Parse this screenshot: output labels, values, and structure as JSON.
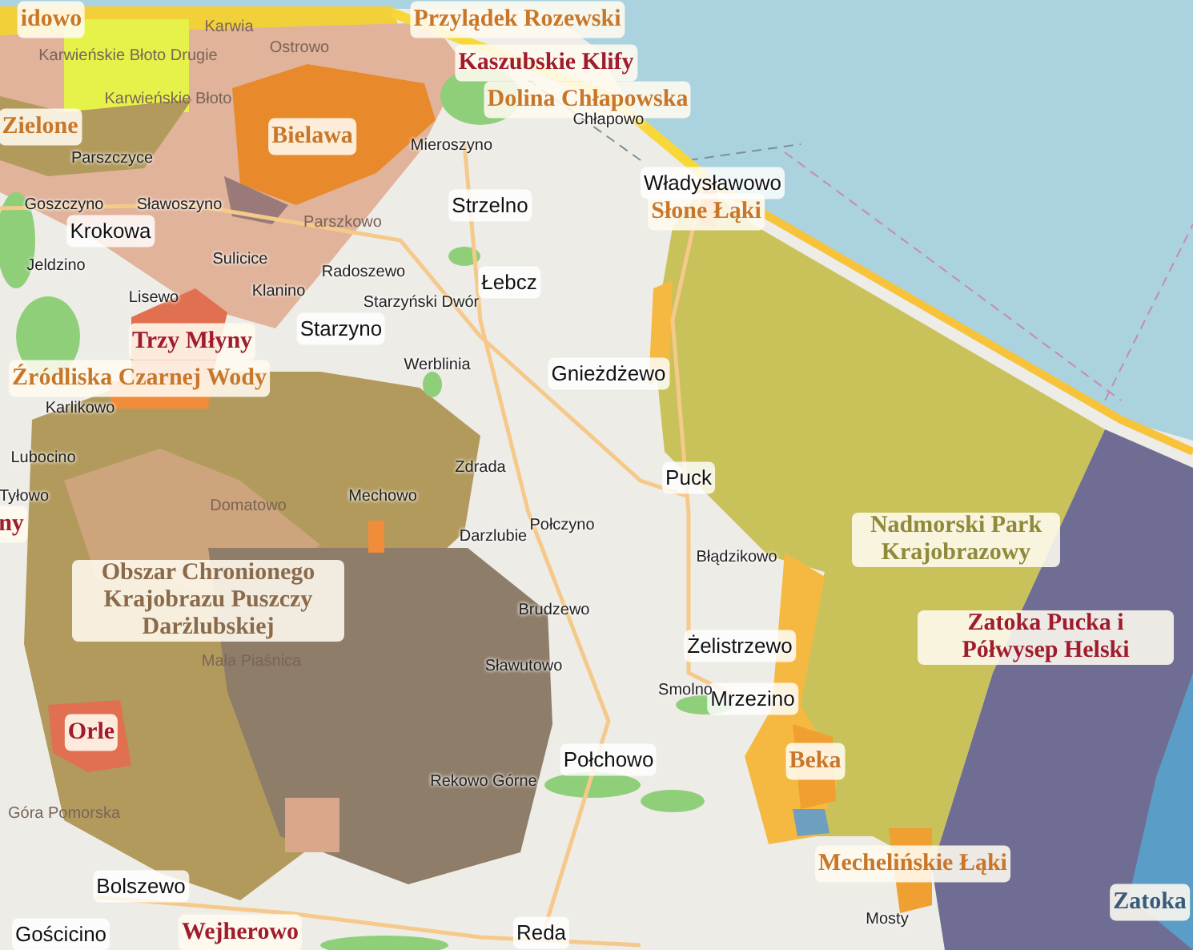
{
  "map": {
    "labels": [
      {
        "kind": "area",
        "text": "idowo",
        "color": "#c8772a"
      },
      {
        "kind": "area",
        "text": "Przylądek Rozewski",
        "color": "#c8772a"
      },
      {
        "kind": "area",
        "text": "Kaszubskie Klify",
        "color": "#a01c2c"
      },
      {
        "kind": "area",
        "text": "Dolina Chłapowska",
        "color": "#c8772a"
      },
      {
        "kind": "area",
        "text": "Zielone",
        "color": "#c8772a"
      },
      {
        "kind": "area",
        "text": "Bielawa",
        "color": "#c8772a"
      },
      {
        "kind": "area",
        "text": "Słone Łąki",
        "color": "#c8772a"
      },
      {
        "kind": "area",
        "text": "Trzy Młyny",
        "color": "#a01c2c"
      },
      {
        "kind": "area",
        "text": "Źródliska Czarnej Wody",
        "color": "#c8772a"
      },
      {
        "kind": "area",
        "text": "ny",
        "color": "#a01c2c"
      },
      {
        "kind": "area",
        "text": "Obszar Chronionego Krajobrazu Puszczy Darżlubskiej",
        "color": "#8a6a4a"
      },
      {
        "kind": "area",
        "text": "Nadmorski Park Krajobrazowy",
        "color": "#8f8a3a"
      },
      {
        "kind": "area",
        "text": "Zatoka Pucka i Półwysep Helski",
        "color": "#a01c2c"
      },
      {
        "kind": "area",
        "text": "Orle",
        "color": "#a01c2c"
      },
      {
        "kind": "area",
        "text": "Beka",
        "color": "#c8772a"
      },
      {
        "kind": "area",
        "text": "Mechelińskie Łąki",
        "color": "#c8772a"
      },
      {
        "kind": "area",
        "text": "Zatoka",
        "color": "#3a5a7a"
      },
      {
        "kind": "area",
        "text": "Wejherowo",
        "color": "#a01c2c"
      },
      {
        "kind": "town",
        "text": "Krokowa"
      },
      {
        "kind": "town",
        "text": "Strzelno"
      },
      {
        "kind": "town",
        "text": "Łebcz"
      },
      {
        "kind": "town",
        "text": "Starzyno"
      },
      {
        "kind": "town",
        "text": "Gnieżdżewo"
      },
      {
        "kind": "town",
        "text": "Puck"
      },
      {
        "kind": "town",
        "text": "Żelistrzewo"
      },
      {
        "kind": "town",
        "text": "Połchowo"
      },
      {
        "kind": "town",
        "text": "Bolszewo"
      },
      {
        "kind": "town",
        "text": "Gościcino"
      },
      {
        "kind": "town",
        "text": "Reda"
      },
      {
        "kind": "town",
        "text": "Władysławowo"
      },
      {
        "kind": "town",
        "text": "Mrzezino"
      },
      {
        "kind": "village",
        "text": "Chłapowo"
      },
      {
        "kind": "village",
        "text": "Mieroszyno"
      },
      {
        "kind": "village",
        "text": "Parszczyce"
      },
      {
        "kind": "village",
        "text": "Goszczyno"
      },
      {
        "kind": "village",
        "text": "Sławoszyno"
      },
      {
        "kind": "village",
        "text": "Jeldzino"
      },
      {
        "kind": "village",
        "text": "Sulicice"
      },
      {
        "kind": "village",
        "text": "Lisewo"
      },
      {
        "kind": "village",
        "text": "Klanino"
      },
      {
        "kind": "village",
        "text": "Radoszewo"
      },
      {
        "kind": "village",
        "text": "Starzyński Dwór"
      },
      {
        "kind": "village",
        "text": "Werblinia"
      },
      {
        "kind": "village",
        "text": "Karlikowo"
      },
      {
        "kind": "village",
        "text": "Lubocino"
      },
      {
        "kind": "village",
        "text": "Zdrada"
      },
      {
        "kind": "village",
        "text": "Mechowo"
      },
      {
        "kind": "village",
        "text": "Darzlubie"
      },
      {
        "kind": "village",
        "text": "Połczyno"
      },
      {
        "kind": "village",
        "text": "Brudzewo"
      },
      {
        "kind": "village",
        "text": "Błądzikowo"
      },
      {
        "kind": "village",
        "text": "Sławutowo"
      },
      {
        "kind": "village",
        "text": "Smolno"
      },
      {
        "kind": "village",
        "text": "Rekowo Górne"
      },
      {
        "kind": "village",
        "text": "Mosty"
      },
      {
        "kind": "village",
        "text": "Tyłowo"
      },
      {
        "kind": "locality",
        "text": "Karwia"
      },
      {
        "kind": "locality",
        "text": "Ostrowo"
      },
      {
        "kind": "locality",
        "text": "Karwieńskie Błoto Drugie"
      },
      {
        "kind": "locality",
        "text": "Karwieńskie Błoto"
      },
      {
        "kind": "locality",
        "text": "Parszkowo"
      },
      {
        "kind": "locality",
        "text": "Domatowo"
      },
      {
        "kind": "locality",
        "text": "Mała Piaśnica"
      },
      {
        "kind": "locality",
        "text": "Góra Pomorska"
      }
    ]
  }
}
